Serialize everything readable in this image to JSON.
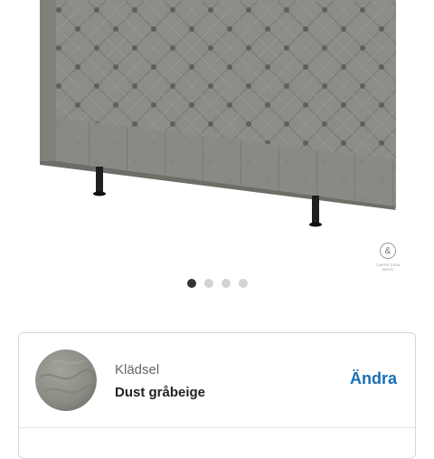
{
  "gallery": {
    "product_image": "upholstered-tufted-headboard",
    "brand_logo": {
      "icon": "ampersand-seal-icon",
      "glyph": "&",
      "text": "CARPE DIEM BEDS"
    },
    "carousel": {
      "page_count": 4,
      "active_index": 0,
      "active_color": "#333333",
      "inactive_color": "#d3d3d3"
    }
  },
  "option": {
    "label": "Klädsel",
    "value": "Dust gråbeige",
    "swatch": "fabric-swatch",
    "swatch_color": "#8b8a83",
    "change_label": "Ändra",
    "accent_color": "#1a6fb5"
  }
}
